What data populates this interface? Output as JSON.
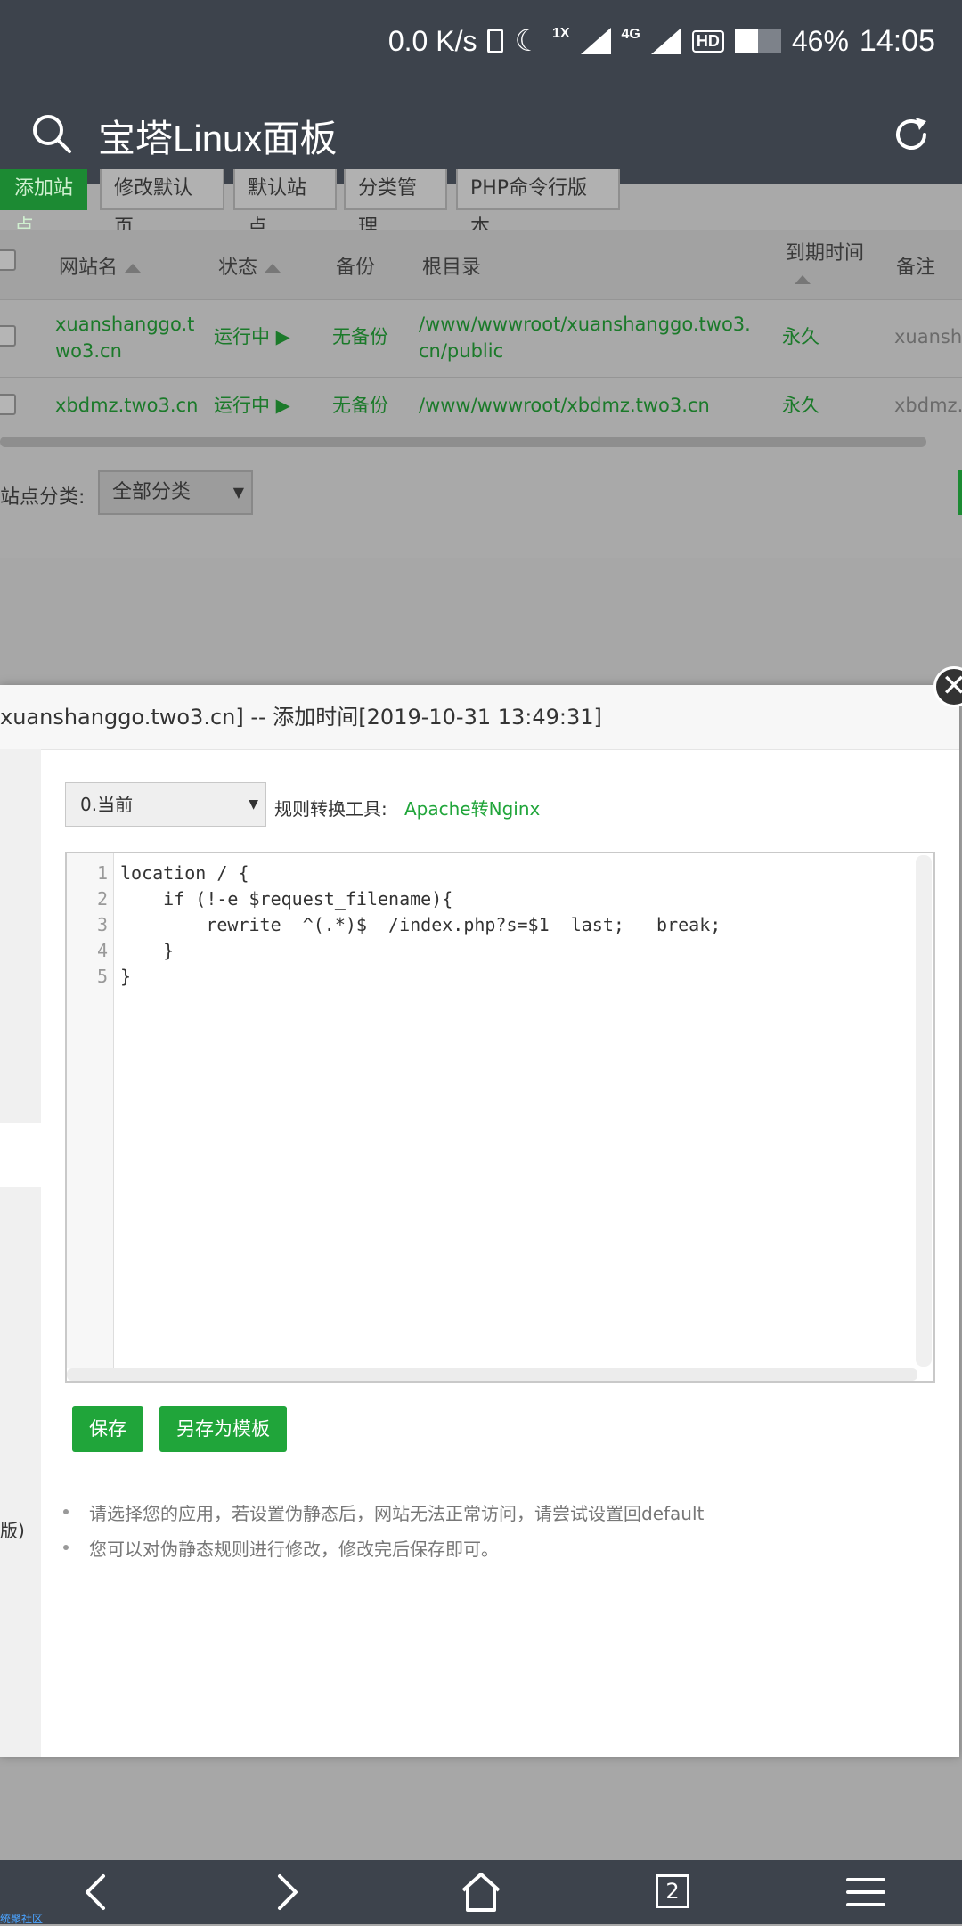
{
  "statusbar": {
    "speed": "0.0 K/s",
    "network_mode": "1X",
    "network_type": "4G",
    "hd": "HD",
    "battery": "46%",
    "time": "14:05"
  },
  "header": {
    "title": "宝塔Linux面板"
  },
  "toolbar": {
    "add_site": "添加站点",
    "modify_default_page": "修改默认页",
    "default_site": "默认站点",
    "category_manage": "分类管理",
    "php_cli_version": "PHP命令行版本"
  },
  "table": {
    "headers": {
      "site_name": "网站名",
      "status": "状态",
      "backup": "备份",
      "root_dir": "根目录",
      "expire": "到期时间",
      "note": "备注"
    },
    "rows": [
      {
        "name": "xuanshanggo.two3.cn",
        "status": "运行中 ▶",
        "backup": "无备份",
        "root": "/www/wwwroot/xuanshanggo.two3.cn/public",
        "expire": "永久",
        "note": "xuansha"
      },
      {
        "name": "xbdmz.two3.cn",
        "status": "运行中 ▶",
        "backup": "无备份",
        "root": "/www/wwwroot/xbdmz.two3.cn",
        "expire": "永久",
        "note": "xbdmz.t"
      }
    ]
  },
  "filter": {
    "label": "站点分类:",
    "value": "全部分类"
  },
  "dialog": {
    "title": "xuanshanggo.two3.cn] -- 添加时间[2019-10-31 13:49:31]",
    "side_version_text": "版)",
    "version_select": "0.当前",
    "converter_label": "规则转换工具:",
    "converter_link": "Apache转Nginx",
    "code_lines": [
      "location / {",
      "    if (!-e $request_filename){",
      "        rewrite  ^(.*)$  /index.php?s=$1  last;   break;",
      "    }",
      "}"
    ],
    "line_numbers": [
      "1",
      "2",
      "3",
      "4",
      "5"
    ],
    "save_label": "保存",
    "save_template_label": "另存为模板",
    "notes": [
      "请选择您的应用，若设置伪静态后，网站无法正常访问，请尝试设置回default",
      "您可以对伪静态规则进行修改，修改完后保存即可。"
    ],
    "close_glyph": "✕"
  },
  "bottomnav": {
    "tab_count": "2"
  },
  "brand": "统聚社区",
  "colors": {
    "accent": "#20a53a",
    "header": "#3d434c"
  }
}
